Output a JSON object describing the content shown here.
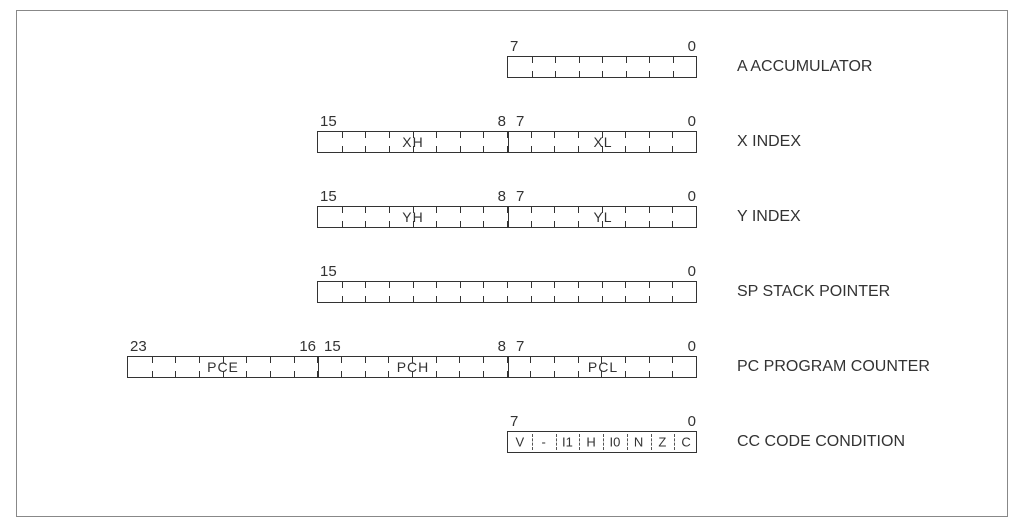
{
  "registers": {
    "a": {
      "desc": "A ACCUMULATOR",
      "high": "7",
      "low": "0"
    },
    "x": {
      "desc": "X INDEX",
      "hh": "15",
      "hl": "8",
      "lh": "7",
      "ll": "0",
      "seg_hi": "XH",
      "seg_lo": "XL"
    },
    "y": {
      "desc": "Y INDEX",
      "hh": "15",
      "hl": "8",
      "lh": "7",
      "ll": "0",
      "seg_hi": "YH",
      "seg_lo": "YL"
    },
    "sp": {
      "desc": "SP STACK POINTER",
      "high": "15",
      "low": "0"
    },
    "pc": {
      "desc": "PC PROGRAM COUNTER",
      "b23": "23",
      "b16": "16",
      "b15": "15",
      "b8": "8",
      "b7": "7",
      "b0": "0",
      "seg_e": "PCE",
      "seg_h": "PCH",
      "seg_l": "PCL"
    },
    "cc": {
      "desc": "CC CODE CONDITION",
      "high": "7",
      "low": "0",
      "bits": {
        "b7": "V",
        "b6": "-",
        "b5": "I1",
        "b4": "H",
        "b3": "I0",
        "b2": "N",
        "b1": "Z",
        "b0": "C"
      }
    }
  },
  "chart_data": {
    "type": "table",
    "title": "CPU programming model / register layout",
    "registers": [
      {
        "name": "A",
        "description": "ACCUMULATOR",
        "width_bits": 8,
        "bit_range": [
          7,
          0
        ],
        "fields": []
      },
      {
        "name": "X",
        "description": "INDEX",
        "width_bits": 16,
        "bit_range": [
          15,
          0
        ],
        "fields": [
          {
            "name": "XH",
            "bits": [
              15,
              8
            ]
          },
          {
            "name": "XL",
            "bits": [
              7,
              0
            ]
          }
        ]
      },
      {
        "name": "Y",
        "description": "INDEX",
        "width_bits": 16,
        "bit_range": [
          15,
          0
        ],
        "fields": [
          {
            "name": "YH",
            "bits": [
              15,
              8
            ]
          },
          {
            "name": "YL",
            "bits": [
              7,
              0
            ]
          }
        ]
      },
      {
        "name": "SP",
        "description": "STACK POINTER",
        "width_bits": 16,
        "bit_range": [
          15,
          0
        ],
        "fields": []
      },
      {
        "name": "PC",
        "description": "PROGRAM COUNTER",
        "width_bits": 24,
        "bit_range": [
          23,
          0
        ],
        "fields": [
          {
            "name": "PCE",
            "bits": [
              23,
              16
            ]
          },
          {
            "name": "PCH",
            "bits": [
              15,
              8
            ]
          },
          {
            "name": "PCL",
            "bits": [
              7,
              0
            ]
          }
        ]
      },
      {
        "name": "CC",
        "description": "CODE CONDITION",
        "width_bits": 8,
        "bit_range": [
          7,
          0
        ],
        "fields": [
          {
            "name": "V",
            "bits": [
              7,
              7
            ]
          },
          {
            "name": "-",
            "bits": [
              6,
              6
            ]
          },
          {
            "name": "I1",
            "bits": [
              5,
              5
            ]
          },
          {
            "name": "H",
            "bits": [
              4,
              4
            ]
          },
          {
            "name": "I0",
            "bits": [
              3,
              3
            ]
          },
          {
            "name": "N",
            "bits": [
              2,
              2
            ]
          },
          {
            "name": "Z",
            "bits": [
              1,
              1
            ]
          },
          {
            "name": "C",
            "bits": [
              0,
              0
            ]
          }
        ]
      }
    ]
  }
}
